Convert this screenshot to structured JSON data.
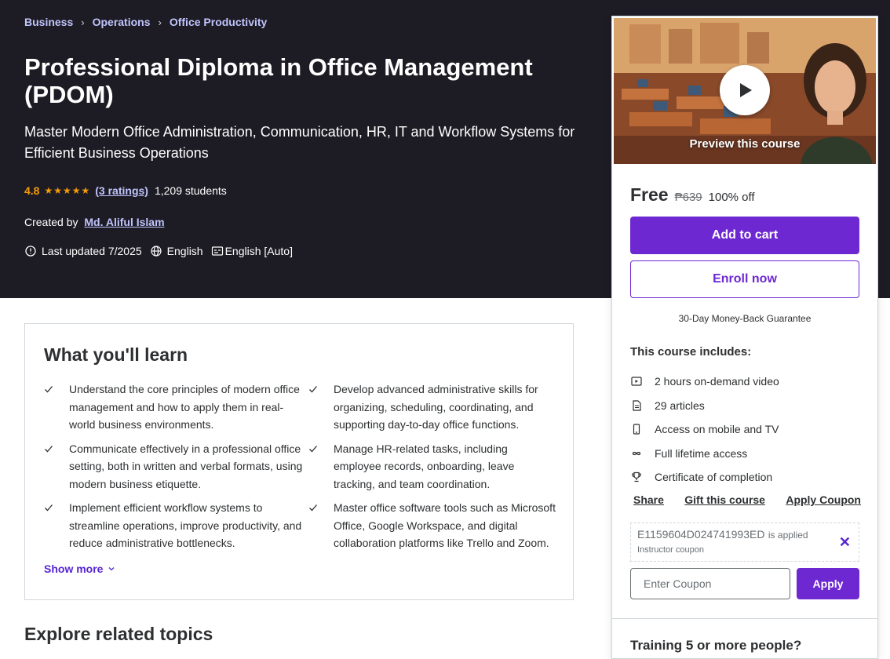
{
  "breadcrumb": [
    "Business",
    "Operations",
    "Office Productivity"
  ],
  "course": {
    "title": "Professional Diploma in Office Management (PDOM)",
    "subtitle": "Master Modern Office Administration, Communication, HR, IT and Workflow Systems for Efficient Business Operations",
    "rating": "4.8",
    "stars": "★★★★★",
    "ratings_link": "(3 ratings)",
    "students": "1,209 students",
    "created_by_label": "Created by",
    "author": "Md. Aliful Islam",
    "last_updated": "Last updated 7/2025",
    "language": "English",
    "captions": "English [Auto]"
  },
  "learn": {
    "heading": "What you'll learn",
    "items": [
      "Understand the core principles of modern office management and how to apply them in real-world business environments.",
      "Develop advanced administrative skills for organizing, scheduling, coordinating, and supporting day-to-day office functions.",
      "Communicate effectively in a professional office setting, both in written and verbal formats, using modern business etiquette.",
      "Manage HR-related tasks, including employee records, onboarding, leave tracking, and team coordination.",
      "Implement efficient workflow systems to streamline operations, improve productivity, and reduce administrative bottlenecks.",
      "Master office software tools such as Microsoft Office, Google Workspace, and digital collaboration platforms like Trello and Zoom."
    ],
    "show_more": "Show more"
  },
  "related_heading": "Explore related topics",
  "sidebar": {
    "preview_label": "Preview this course",
    "price": "Free",
    "original_price": "₱639",
    "discount": "100% off",
    "add_to_cart": "Add to cart",
    "enroll_now": "Enroll now",
    "guarantee": "30-Day Money-Back Guarantee",
    "includes_title": "This course includes:",
    "includes": [
      {
        "icon": "video-icon",
        "label": "2 hours on-demand video"
      },
      {
        "icon": "article-icon",
        "label": "29 articles"
      },
      {
        "icon": "mobile-icon",
        "label": "Access on mobile and TV"
      },
      {
        "icon": "infinity-icon",
        "label": "Full lifetime access"
      },
      {
        "icon": "trophy-icon",
        "label": "Certificate of completion"
      }
    ],
    "share": "Share",
    "gift": "Gift this course",
    "apply_coupon": "Apply Coupon",
    "coupon_code": "E1159604D024741993ED",
    "coupon_applied": "is applied",
    "coupon_type": "Instructor coupon",
    "coupon_placeholder": "Enter Coupon",
    "apply_button": "Apply",
    "training_partial": "Training 5 or more people?"
  },
  "colors": {
    "hero_bg": "#1d1c25",
    "accent_purple": "#6d28d2",
    "link_lavender": "#c0c4fc",
    "star_orange": "#f69c08"
  }
}
